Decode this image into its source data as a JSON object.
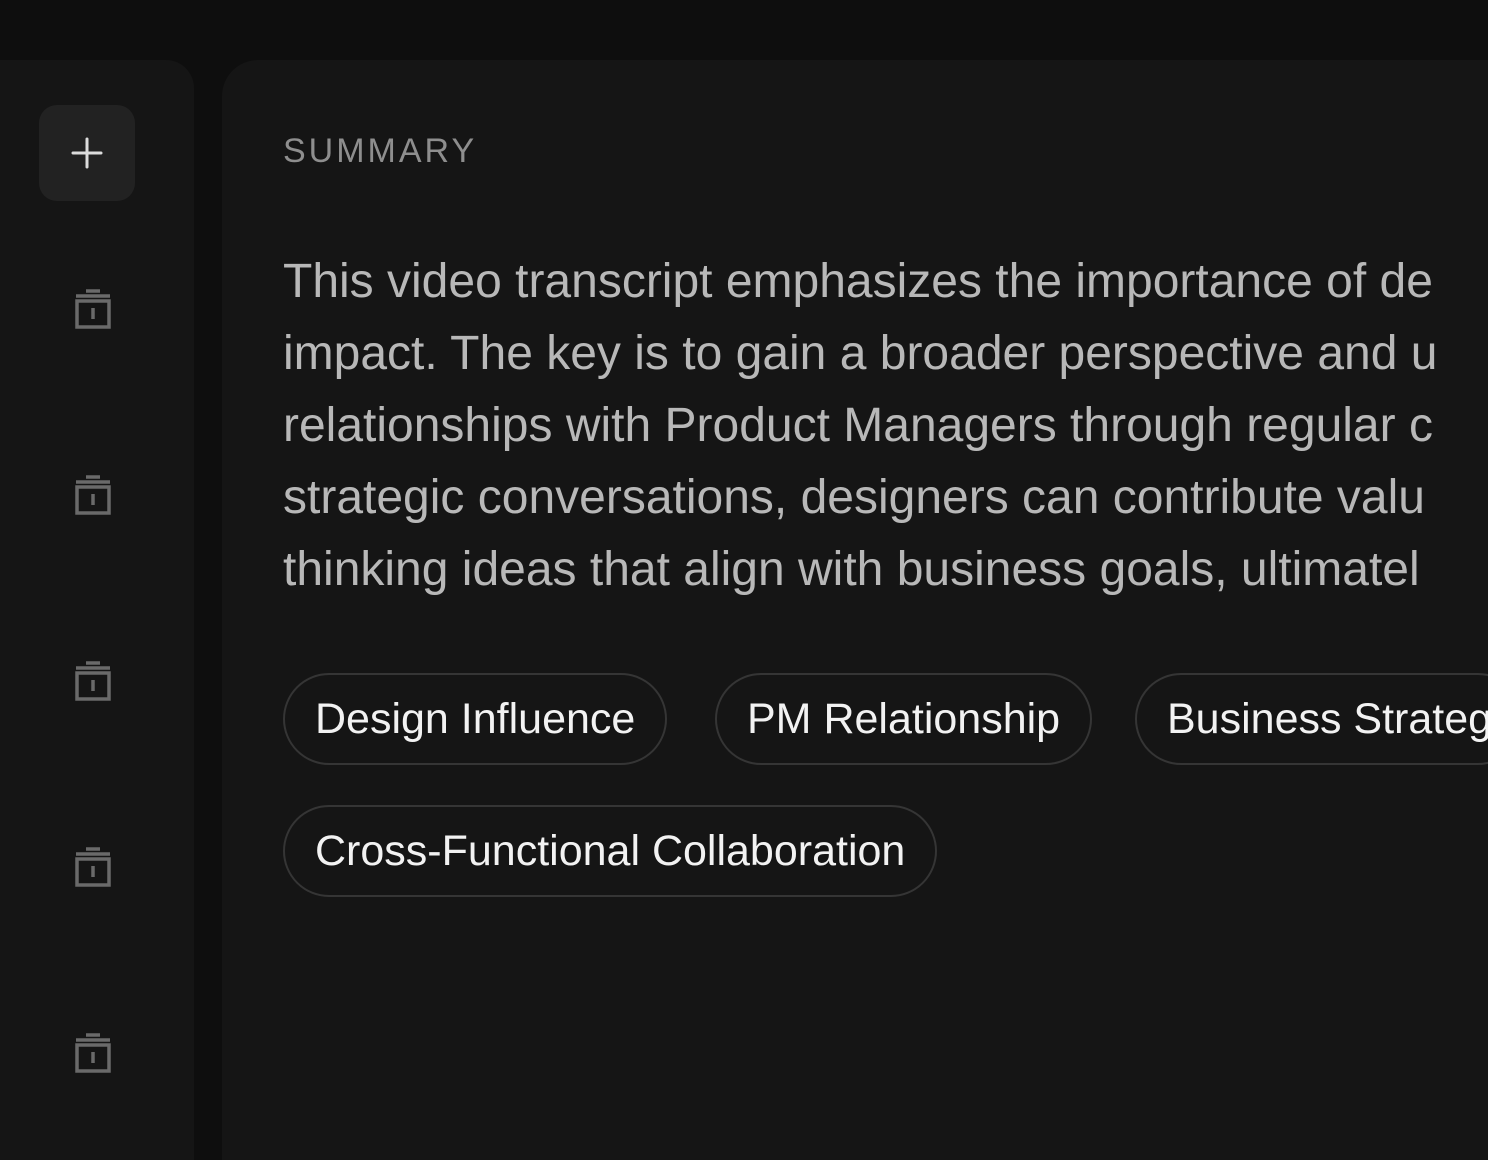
{
  "sidebar": {
    "add_icon": "plus-icon",
    "items": [
      {
        "icon": "trash-icon"
      },
      {
        "icon": "trash-icon"
      },
      {
        "icon": "trash-icon"
      },
      {
        "icon": "trash-icon"
      },
      {
        "icon": "trash-icon"
      }
    ]
  },
  "main": {
    "section_title": "SUMMARY",
    "summary_lines": [
      "This video transcript emphasizes the importance of de",
      "impact. The key is to gain a broader perspective and u",
      "relationships with Product Managers through regular c",
      "strategic conversations, designers can contribute valu",
      "thinking ideas that align with business goals, ultimatel"
    ],
    "tags": [
      {
        "label": "Design Influence"
      },
      {
        "label": "PM Relationship"
      },
      {
        "label": "Business Strateg"
      },
      {
        "label": "Cross-Functional Collaboration"
      }
    ]
  },
  "colors": {
    "background": "#0e0e0e",
    "panel": "#151515",
    "add_button": "#222222",
    "title_text": "#8e8e8e",
    "body_text": "#b8b8b8",
    "tag_text": "#f2f2f2",
    "tag_border": "#353535",
    "icon": "#6a6a6a"
  }
}
